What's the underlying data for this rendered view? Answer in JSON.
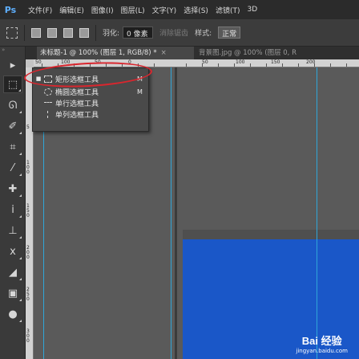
{
  "menubar": {
    "logo": "Ps",
    "items": [
      "文件(F)",
      "编辑(E)",
      "图像(I)",
      "图层(L)",
      "文字(Y)",
      "选择(S)",
      "滤镜(T)",
      "3D"
    ]
  },
  "options_bar": {
    "feather_label": "羽化:",
    "feather_value": "0 像素",
    "antialias_label": "消除锯齿",
    "style_label": "样式:",
    "style_value": "正常"
  },
  "doc_tabs": [
    {
      "label": "未标题-1 @ 100% (图层 1, RGB/8) *",
      "close": "×"
    },
    {
      "label": "背景图.jpg @ 100% (图层 0, R"
    }
  ],
  "ruler_top": [
    "50",
    "100",
    "50",
    "0",
    "50",
    "100",
    "150",
    "200"
  ],
  "ruler_left": [
    "5",
    "1\n0\n0",
    "1\n5\n0",
    "2\n0\n0",
    "2\n5\n0",
    "3\n0\n0"
  ],
  "flyout": {
    "items": [
      {
        "label": "矩形选框工具",
        "key": "M",
        "bullet": "■"
      },
      {
        "label": "椭圆选框工具",
        "key": "M",
        "bullet": ""
      },
      {
        "label": "单行选框工具",
        "key": "",
        "bullet": ""
      },
      {
        "label": "单列选框工具",
        "key": "",
        "bullet": ""
      }
    ]
  },
  "watermark": {
    "logo": "Bai 经验",
    "site": "jingyan.baidu.com"
  },
  "colors": {
    "accent": "#2fa6d8",
    "annotation": "#d9262e",
    "image_blue": "#1a57c8"
  },
  "icons": [
    "move-icon",
    "rect-marquee-icon",
    "lasso-icon",
    "quick-select-icon",
    "crop-icon",
    "eyedropper-icon",
    "healing-icon",
    "brush-icon",
    "stamp-icon",
    "history-brush-icon",
    "eraser-icon",
    "gradient-icon",
    "blur-icon"
  ]
}
